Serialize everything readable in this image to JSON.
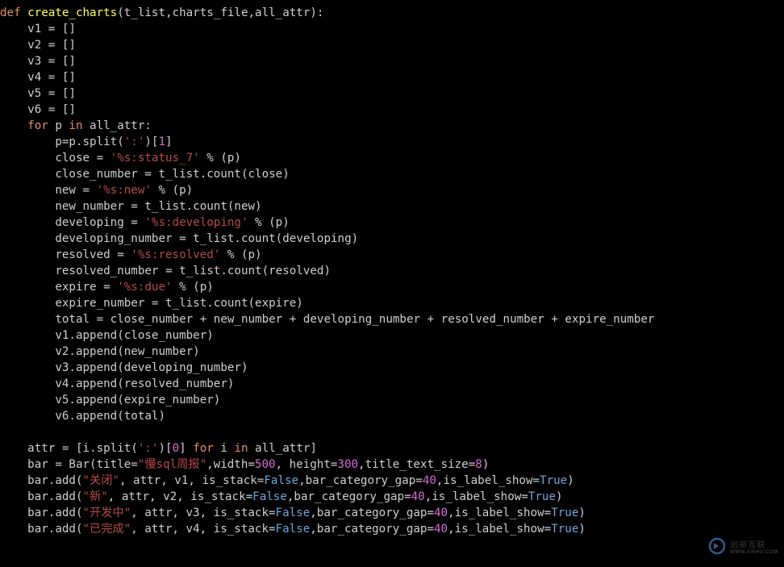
{
  "code": {
    "lines": [
      [
        [
          "kw",
          "def "
        ],
        [
          "fn",
          "create_charts"
        ],
        [
          "id",
          "(t_list,charts_file,all_attr):"
        ]
      ],
      [
        [
          "id",
          "    v1 = []"
        ]
      ],
      [
        [
          "id",
          "    v2 = []"
        ]
      ],
      [
        [
          "id",
          "    v3 = []"
        ]
      ],
      [
        [
          "id",
          "    v4 = []"
        ]
      ],
      [
        [
          "id",
          "    v5 = []"
        ]
      ],
      [
        [
          "id",
          "    v6 = []"
        ]
      ],
      [
        [
          "id",
          "    "
        ],
        [
          "kw",
          "for"
        ],
        [
          "id",
          " p "
        ],
        [
          "kw",
          "in"
        ],
        [
          "id",
          " all_attr:"
        ]
      ],
      [
        [
          "id",
          "        p=p.split("
        ],
        [
          "str",
          "':'"
        ],
        [
          "id",
          ")["
        ],
        [
          "num",
          "1"
        ],
        [
          "id",
          "]"
        ]
      ],
      [
        [
          "id",
          "        close = "
        ],
        [
          "str",
          "'%s:status_7'"
        ],
        [
          "id",
          " % (p)"
        ]
      ],
      [
        [
          "id",
          "        close_number = t_list.count(close)"
        ]
      ],
      [
        [
          "id",
          "        new = "
        ],
        [
          "str",
          "'%s:new'"
        ],
        [
          "id",
          " % (p)"
        ]
      ],
      [
        [
          "id",
          "        new_number = t_list.count(new)"
        ]
      ],
      [
        [
          "id",
          "        developing = "
        ],
        [
          "str",
          "'%s:developing'"
        ],
        [
          "id",
          " % (p)"
        ]
      ],
      [
        [
          "id",
          "        developing_number = t_list.count(developing)"
        ]
      ],
      [
        [
          "id",
          "        resolved = "
        ],
        [
          "str",
          "'%s:resolved'"
        ],
        [
          "id",
          " % (p)"
        ]
      ],
      [
        [
          "id",
          "        resolved_number = t_list.count(resolved)"
        ]
      ],
      [
        [
          "id",
          "        expire = "
        ],
        [
          "str",
          "'%s:due'"
        ],
        [
          "id",
          " % (p)"
        ]
      ],
      [
        [
          "id",
          "        expire_number = t_list.count(expire)"
        ]
      ],
      [
        [
          "id",
          "        total = close_number + new_number + developing_number + resolved_number + expire_number"
        ]
      ],
      [
        [
          "id",
          "        v1.append(close_number)"
        ]
      ],
      [
        [
          "id",
          "        v2.append(new_number)"
        ]
      ],
      [
        [
          "id",
          "        v3.append(developing_number)"
        ]
      ],
      [
        [
          "id",
          "        v4.append(resolved_number)"
        ]
      ],
      [
        [
          "id",
          "        v5.append(expire_number)"
        ]
      ],
      [
        [
          "id",
          "        v6.append(total)"
        ]
      ],
      [
        [
          "id",
          ""
        ]
      ],
      [
        [
          "id",
          "    attr = [i.split("
        ],
        [
          "str",
          "':'"
        ],
        [
          "id",
          ")["
        ],
        [
          "num",
          "0"
        ],
        [
          "id",
          "] "
        ],
        [
          "kw",
          "for"
        ],
        [
          "id",
          " i "
        ],
        [
          "kw",
          "in"
        ],
        [
          "id",
          " all_attr]"
        ]
      ],
      [
        [
          "id",
          "    bar = Bar(title="
        ],
        [
          "str",
          "\"慢sql周报\""
        ],
        [
          "id",
          ",width="
        ],
        [
          "num",
          "500"
        ],
        [
          "id",
          ", height="
        ],
        [
          "num",
          "300"
        ],
        [
          "id",
          ",title_text_size="
        ],
        [
          "num",
          "8"
        ],
        [
          "id",
          ")"
        ]
      ],
      [
        [
          "id",
          "    bar.add("
        ],
        [
          "str",
          "\"关闭\""
        ],
        [
          "id",
          ", attr, v1, is_stack="
        ],
        [
          "bool",
          "False"
        ],
        [
          "id",
          ",bar_category_gap="
        ],
        [
          "num",
          "40"
        ],
        [
          "id",
          ",is_label_show="
        ],
        [
          "bool",
          "True"
        ],
        [
          "id",
          ")"
        ]
      ],
      [
        [
          "id",
          "    bar.add("
        ],
        [
          "str",
          "\"新\""
        ],
        [
          "id",
          ", attr, v2, is_stack="
        ],
        [
          "bool",
          "False"
        ],
        [
          "id",
          ",bar_category_gap="
        ],
        [
          "num",
          "40"
        ],
        [
          "id",
          ",is_label_show="
        ],
        [
          "bool",
          "True"
        ],
        [
          "id",
          ")"
        ]
      ],
      [
        [
          "id",
          "    bar.add("
        ],
        [
          "str",
          "\"开发中\""
        ],
        [
          "id",
          ", attr, v3, is_stack="
        ],
        [
          "bool",
          "False"
        ],
        [
          "id",
          ",bar_category_gap="
        ],
        [
          "num",
          "40"
        ],
        [
          "id",
          ",is_label_show="
        ],
        [
          "bool",
          "True"
        ],
        [
          "id",
          ")"
        ]
      ],
      [
        [
          "id",
          "    bar.add("
        ],
        [
          "str",
          "\"已完成\""
        ],
        [
          "id",
          ", attr, v4, is_stack="
        ],
        [
          "bool",
          "False"
        ],
        [
          "id",
          ",bar_category_gap="
        ],
        [
          "num",
          "40"
        ],
        [
          "id",
          ",is_label_show="
        ],
        [
          "bool",
          "True"
        ],
        [
          "id",
          ")"
        ]
      ]
    ]
  },
  "watermark": {
    "brand_zh": "创新互联",
    "brand_sub": "WWW.XINHU.COM"
  }
}
